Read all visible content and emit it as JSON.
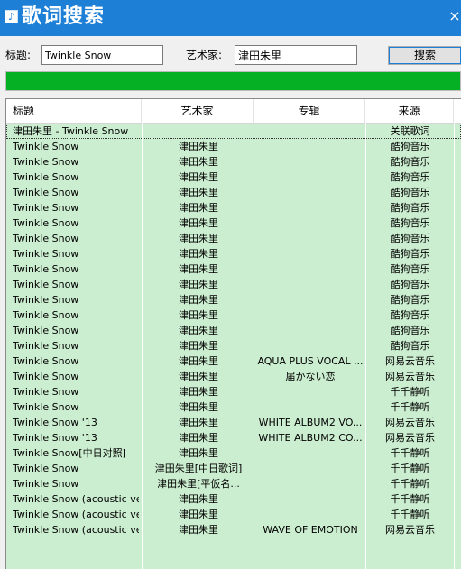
{
  "window": {
    "app_icon_glyph": "♪",
    "title": "歌词搜索",
    "close_glyph": "×"
  },
  "form": {
    "title_label": "标题:",
    "title_value": "Twinkle Snow",
    "artist_label": "艺术家:",
    "artist_value": "津田朱里",
    "search_button": "搜索"
  },
  "progress": {
    "percent": 100,
    "color": "#06b025"
  },
  "table": {
    "columns": [
      "标题",
      "艺术家",
      "专辑",
      "来源"
    ],
    "rows": [
      {
        "title": "津田朱里 - Twinkle Snow",
        "artist": "",
        "album": "",
        "source": "关联歌词"
      },
      {
        "title": "Twinkle Snow",
        "artist": "津田朱里",
        "album": "",
        "source": "酷狗音乐"
      },
      {
        "title": "Twinkle Snow",
        "artist": "津田朱里",
        "album": "",
        "source": "酷狗音乐"
      },
      {
        "title": "Twinkle Snow",
        "artist": "津田朱里",
        "album": "",
        "source": "酷狗音乐"
      },
      {
        "title": "Twinkle Snow",
        "artist": "津田朱里",
        "album": "",
        "source": "酷狗音乐"
      },
      {
        "title": "Twinkle Snow",
        "artist": "津田朱里",
        "album": "",
        "source": "酷狗音乐"
      },
      {
        "title": "Twinkle Snow",
        "artist": "津田朱里",
        "album": "",
        "source": "酷狗音乐"
      },
      {
        "title": "Twinkle Snow",
        "artist": "津田朱里",
        "album": "",
        "source": "酷狗音乐"
      },
      {
        "title": "Twinkle Snow",
        "artist": "津田朱里",
        "album": "",
        "source": "酷狗音乐"
      },
      {
        "title": "Twinkle Snow",
        "artist": "津田朱里",
        "album": "",
        "source": "酷狗音乐"
      },
      {
        "title": "Twinkle Snow",
        "artist": "津田朱里",
        "album": "",
        "source": "酷狗音乐"
      },
      {
        "title": "Twinkle Snow",
        "artist": "津田朱里",
        "album": "",
        "source": "酷狗音乐"
      },
      {
        "title": "Twinkle Snow",
        "artist": "津田朱里",
        "album": "",
        "source": "酷狗音乐"
      },
      {
        "title": "Twinkle Snow",
        "artist": "津田朱里",
        "album": "",
        "source": "酷狗音乐"
      },
      {
        "title": "Twinkle Snow",
        "artist": "津田朱里",
        "album": "",
        "source": "酷狗音乐"
      },
      {
        "title": "Twinkle Snow",
        "artist": "津田朱里",
        "album": "AQUA PLUS VOCAL ...",
        "source": "网易云音乐"
      },
      {
        "title": "Twinkle Snow",
        "artist": "津田朱里",
        "album": "届かない恋",
        "source": "网易云音乐"
      },
      {
        "title": "Twinkle Snow",
        "artist": "津田朱里",
        "album": "",
        "source": "千千静听"
      },
      {
        "title": "Twinkle Snow",
        "artist": "津田朱里",
        "album": "",
        "source": "千千静听"
      },
      {
        "title": "Twinkle Snow '13",
        "artist": "津田朱里",
        "album": "WHITE ALBUM2 VO...",
        "source": "网易云音乐"
      },
      {
        "title": "Twinkle Snow '13",
        "artist": "津田朱里",
        "album": "WHITE ALBUM2 CO...",
        "source": "网易云音乐"
      },
      {
        "title": "Twinkle Snow[中日对照]",
        "artist": "津田朱里",
        "album": "",
        "source": "千千静听"
      },
      {
        "title": "Twinkle Snow",
        "artist": "津田朱里[中日歌词]",
        "album": "",
        "source": "千千静听"
      },
      {
        "title": "Twinkle Snow",
        "artist": "津田朱里[平仮名...",
        "album": "",
        "source": "千千静听"
      },
      {
        "title": "Twinkle Snow (acoustic ve...",
        "artist": "津田朱里",
        "album": "",
        "source": "千千静听"
      },
      {
        "title": "Twinkle Snow (acoustic ve...",
        "artist": "津田朱里",
        "album": "",
        "source": "千千静听"
      },
      {
        "title": "Twinkle Snow (acoustic ve...",
        "artist": "津田朱里",
        "album": "WAVE OF EMOTION",
        "source": "网易云音乐"
      }
    ]
  }
}
